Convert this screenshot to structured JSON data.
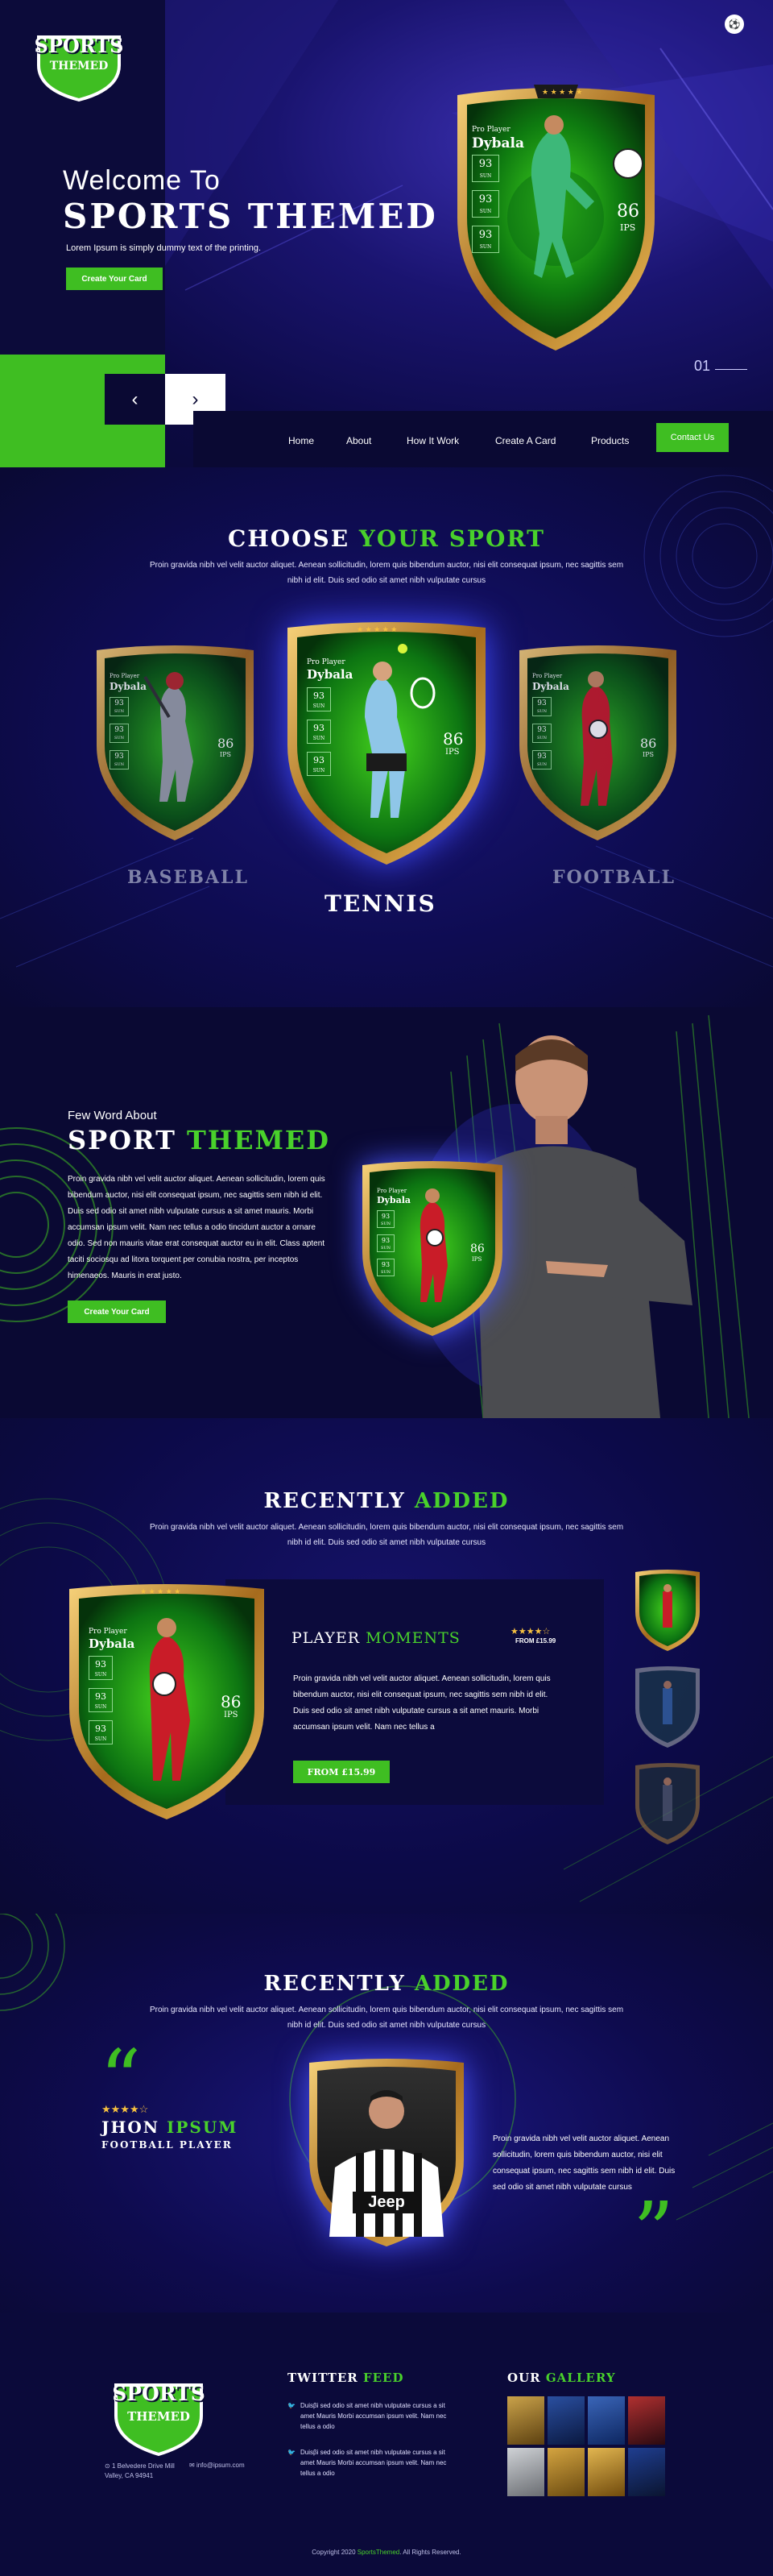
{
  "brand": {
    "line1": "SPORTS",
    "line2": "THEMED"
  },
  "hero": {
    "welcome": "Welcome To",
    "title": "SPORTS THEMED",
    "subtitle": "Lorem Ipsum is simply dummy text of the printing.",
    "cta": "Create Your Card",
    "slide_number": "01",
    "prev": "‹",
    "next": "›",
    "card": {
      "role": "Pro Player",
      "name": "Dybala",
      "stats": [
        "93",
        "93",
        "93"
      ],
      "stat_label": "SUN",
      "rating": "86",
      "rating_label": "IPS"
    }
  },
  "nav": {
    "items": [
      "Home",
      "About",
      "How It Work",
      "Create A Card",
      "Products"
    ],
    "contact": "Contact Us"
  },
  "choose": {
    "title_white": "CHOOSE",
    "title_green": "YOUR SPORT",
    "text": "Proin gravida nibh vel velit auctor aliquet. Aenean sollicitudin, lorem quis bibendum auctor, nisi elit consequat ipsum, nec sagittis sem nibh id elit. Duis sed odio sit amet nibh vulputate cursus",
    "sports": [
      "BASEBALL",
      "TENNIS",
      "FOOTBALL"
    ],
    "card": {
      "role": "Pro Player",
      "name": "Dybala",
      "stat": "93",
      "stat_label": "SUN",
      "rating": "86",
      "rating_label": "IPS"
    }
  },
  "about": {
    "kicker": "Few Word About",
    "title_white": "SPORT",
    "title_green": "THEMED",
    "text": "Proin gravida nibh vel velit auctor aliquet. Aenean sollicitudin, lorem quis bibendum auctor, nisi elit consequat ipsum, nec sagittis sem nibh id elit. Duis sed odio sit amet nibh vulputate cursus a sit amet mauris. Morbi accumsan ipsum velit. Nam nec tellus a odio tincidunt auctor a ornare odio. Sed non mauris vitae erat consequat auctor eu in elit. Class aptent taciti sociosqu ad litora torquent per conubia nostra, per inceptos himenaeos. Mauris in erat justo.",
    "cta": "Create Your Card"
  },
  "recent1": {
    "title_white": "RECENTLY",
    "title_green": "ADDED",
    "text": "Proin gravida nibh vel velit auctor aliquet. Aenean sollicitudin, lorem quis bibendum auctor, nisi elit consequat ipsum, nec sagittis sem nibh id elit. Duis sed odio sit amet nibh vulputate cursus",
    "product_title_white": "PLAYER",
    "product_title_green": "MOMENTS",
    "stars": "★★★★☆",
    "price_small": "FROM £15.99",
    "product_text": "Proin gravida nibh vel velit auctor aliquet. Aenean sollicitudin, lorem quis bibendum auctor, nisi elit consequat ipsum, nec sagittis sem nibh id elit. Duis sed odio sit amet nibh vulputate cursus a sit amet mauris. Morbi accumsan ipsum velit. Nam nec tellus a",
    "price_button": "FROM £15.99",
    "card": {
      "role": "Pro Player",
      "name": "Dybala",
      "stat": "93",
      "stat_label": "SUN",
      "rating": "86",
      "rating_label": "IPS"
    }
  },
  "recent2": {
    "title_white": "RECENTLY",
    "title_green": "ADDED",
    "text": "Proin gravida nibh vel velit auctor aliquet. Aenean sollicitudin, lorem quis bibendum auctor, nisi elit consequat ipsum, nec sagittis sem nibh id elit. Duis sed odio sit amet nibh vulputate cursus",
    "stars": "★★★★☆",
    "name_white": "JHON",
    "name_green": "IPSUM",
    "role": "FOOTBALL PLAYER",
    "quote": "Proin gravida nibh vel velit auctor aliquet. Aenean sollicitudin, lorem quis bibendum auctor, nisi elit consequat ipsum, nec sagittis sem nibh id elit. Duis sed odio sit amet nibh vulputate cursus",
    "jersey": "Jeep"
  },
  "footer": {
    "address": "1 Belvedere Drive Mill Valley, CA 94941",
    "email": "info@ipsum.com",
    "twitter_white": "TWITTER",
    "twitter_green": "FEED",
    "tweets": [
      "Duisβi sed odio sit amet nibh vulputate cursus a sit amet Mauris Morbi accumsan ipsum velit. Nam nec tellus a odio",
      "Duisβi sed odio sit amet nibh vulputate cursus a sit amet Mauris Morbi accumsan ipsum velit. Nam nec tellus a odio"
    ],
    "gallery_white": "OUR",
    "gallery_green": "GALLERY",
    "copyright_prefix": "Copyright  2020",
    "copyright_brand": "SportsThemed",
    "copyright_suffix": ". All Rights Reserved."
  },
  "colors": {
    "accent": "#49d12b",
    "bg": "#0a0933",
    "gold": "#d9a441"
  }
}
